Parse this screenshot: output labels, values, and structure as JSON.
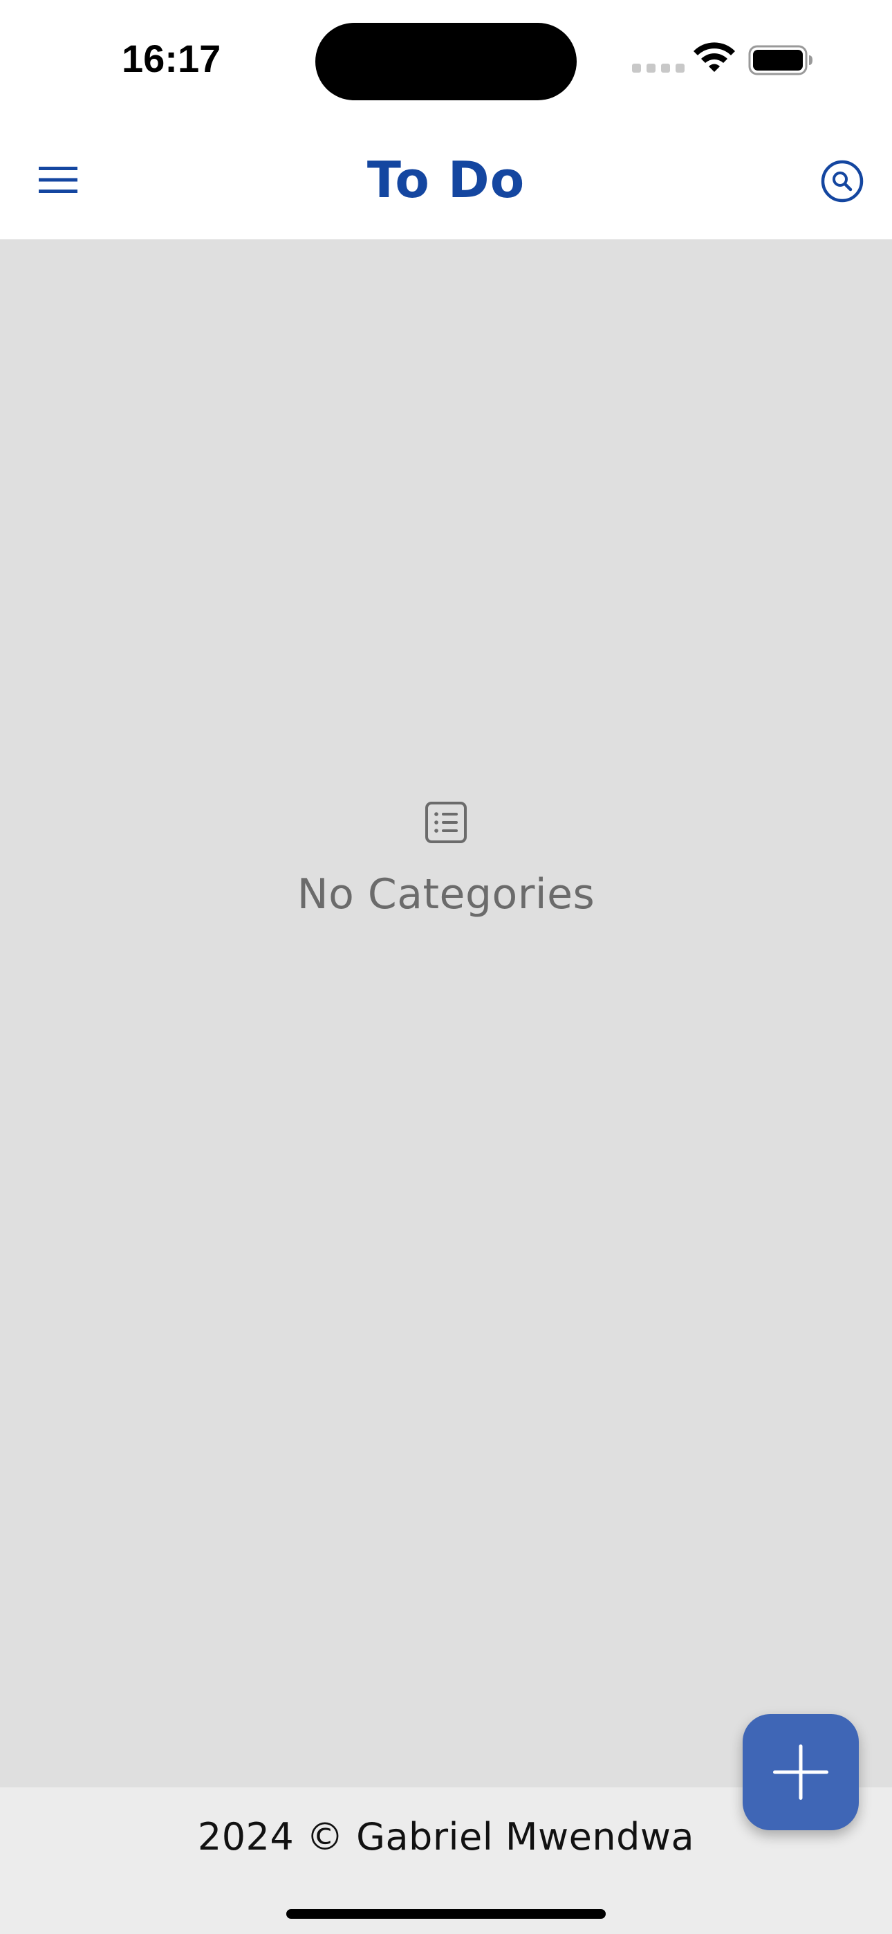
{
  "status_bar": {
    "time": "16:17",
    "icons": [
      "cellular-signal-icon",
      "wifi-icon",
      "battery-icon"
    ]
  },
  "app_bar": {
    "title": "To Do",
    "left_icon": "menu-icon",
    "right_icon": "search-icon"
  },
  "empty_state": {
    "icon": "list-icon",
    "message": "No Categories"
  },
  "fab": {
    "icon": "plus-icon"
  },
  "footer": {
    "text": "2024 © Gabriel Mwendwa"
  },
  "colors": {
    "brand": "#1446a0",
    "fab": "#3f66b6",
    "content_background": "#dfdfdf",
    "footer_background": "#ececec",
    "muted_text": "#6b6b6b"
  }
}
